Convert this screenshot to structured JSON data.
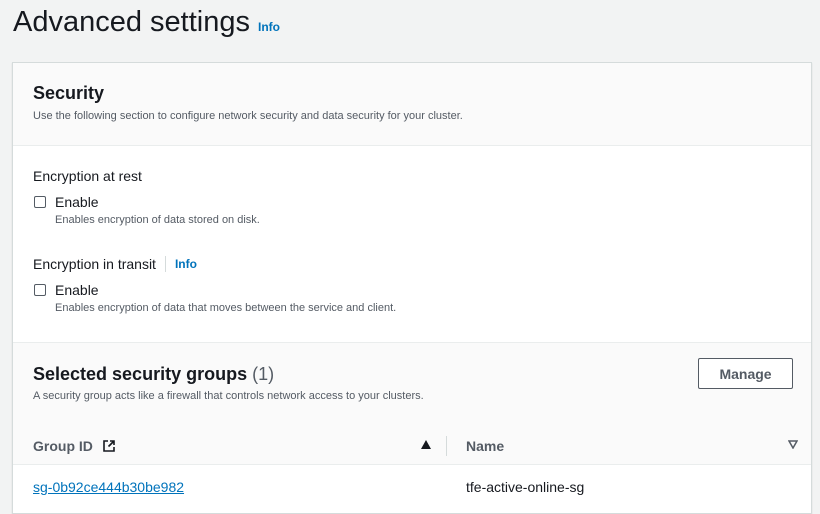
{
  "page": {
    "title": "Advanced settings",
    "info_label": "Info"
  },
  "security": {
    "title": "Security",
    "description": "Use the following section to configure network security and data security for your cluster.",
    "encryption_at_rest": {
      "label": "Encryption at rest",
      "checkbox_label": "Enable",
      "checkbox_description": "Enables encryption of data stored on disk.",
      "checked": false
    },
    "encryption_in_transit": {
      "label": "Encryption in transit",
      "info_label": "Info",
      "checkbox_label": "Enable",
      "checkbox_description": "Enables encryption of data that moves between the service and client.",
      "checked": false
    }
  },
  "security_groups": {
    "title": "Selected security groups",
    "count": "(1)",
    "description": "A security group acts like a firewall that controls network access to your clusters.",
    "manage_label": "Manage",
    "columns": [
      {
        "label": "Group ID",
        "icon": "external-link-icon",
        "sort": "ascending-icon"
      },
      {
        "label": "Name",
        "sort": "sort-descending-icon"
      }
    ],
    "rows": [
      {
        "group_id": "sg-0b92ce444b30be982",
        "name": "tfe-active-online-sg"
      }
    ]
  },
  "colors": {
    "link": "#0073bb",
    "text": "#16191f",
    "secondary_text": "#545b64",
    "background": "#f2f3f3"
  }
}
